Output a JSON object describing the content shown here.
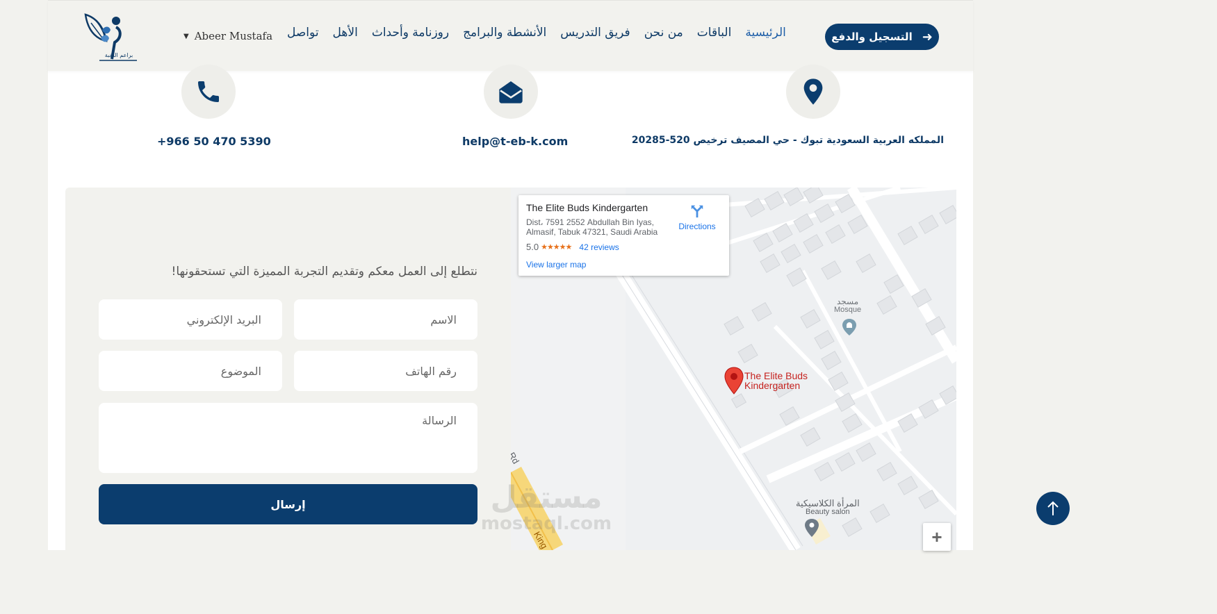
{
  "header": {
    "logo_alt": "براعم النخبة",
    "user_name": "Abeer Mustafa",
    "nav": [
      {
        "label": "الرئيسية",
        "active": true
      },
      {
        "label": "الباقات"
      },
      {
        "label": "من نحن"
      },
      {
        "label": "فريق التدريس"
      },
      {
        "label": "الأنشطة والبرامج"
      },
      {
        "label": "روزنامة وأحداث"
      },
      {
        "label": "الأهل"
      },
      {
        "label": "تواصل"
      }
    ],
    "cta_label": "التسجيل والدفع"
  },
  "contact": {
    "address": "المملكه العربية السعودية تبوك - حي المصيف ترخيص 520-20285",
    "email": "help@t-eb-k.com",
    "phone": "+966 50 470 5390"
  },
  "form": {
    "intro": "نتطلع إلى العمل معكم وتقديم التجربة المميزة التي تستحقونها!",
    "name_placeholder": "الاسم",
    "email_placeholder": "البريد الإلكتروني",
    "phone_placeholder": "رقم الهاتف",
    "subject_placeholder": "الموضوع",
    "message_placeholder": "الرسالة",
    "submit_label": "إرسال"
  },
  "map": {
    "place_name": "The Elite Buds Kindergarten",
    "address": "Dist، 7591 2552 Abdullah Bin Iyas, Almasif, Tabuk 47321, Saudi Arabia",
    "rating": "5.0",
    "stars": "★★★★★",
    "reviews": "42 reviews",
    "directions_label": "Directions",
    "larger_map_label": "View larger map",
    "pin_label_line1": "The Elite Buds",
    "pin_label_line2": "Kindergarten",
    "mosque_ar": "مسجد",
    "mosque_en": "Mosque",
    "salon_ar": "المرأة الكلاسيكية",
    "salon_en": "Beauty salon",
    "road_label": "Rd",
    "road_label2": "King",
    "zoom_in": "+"
  },
  "watermark": {
    "ar": "مستقل",
    "en": "mostaql.com"
  },
  "colors": {
    "primary": "#0b3d6e",
    "nav_text": "#0e3a66",
    "panel_bg": "#f2f2ee"
  }
}
